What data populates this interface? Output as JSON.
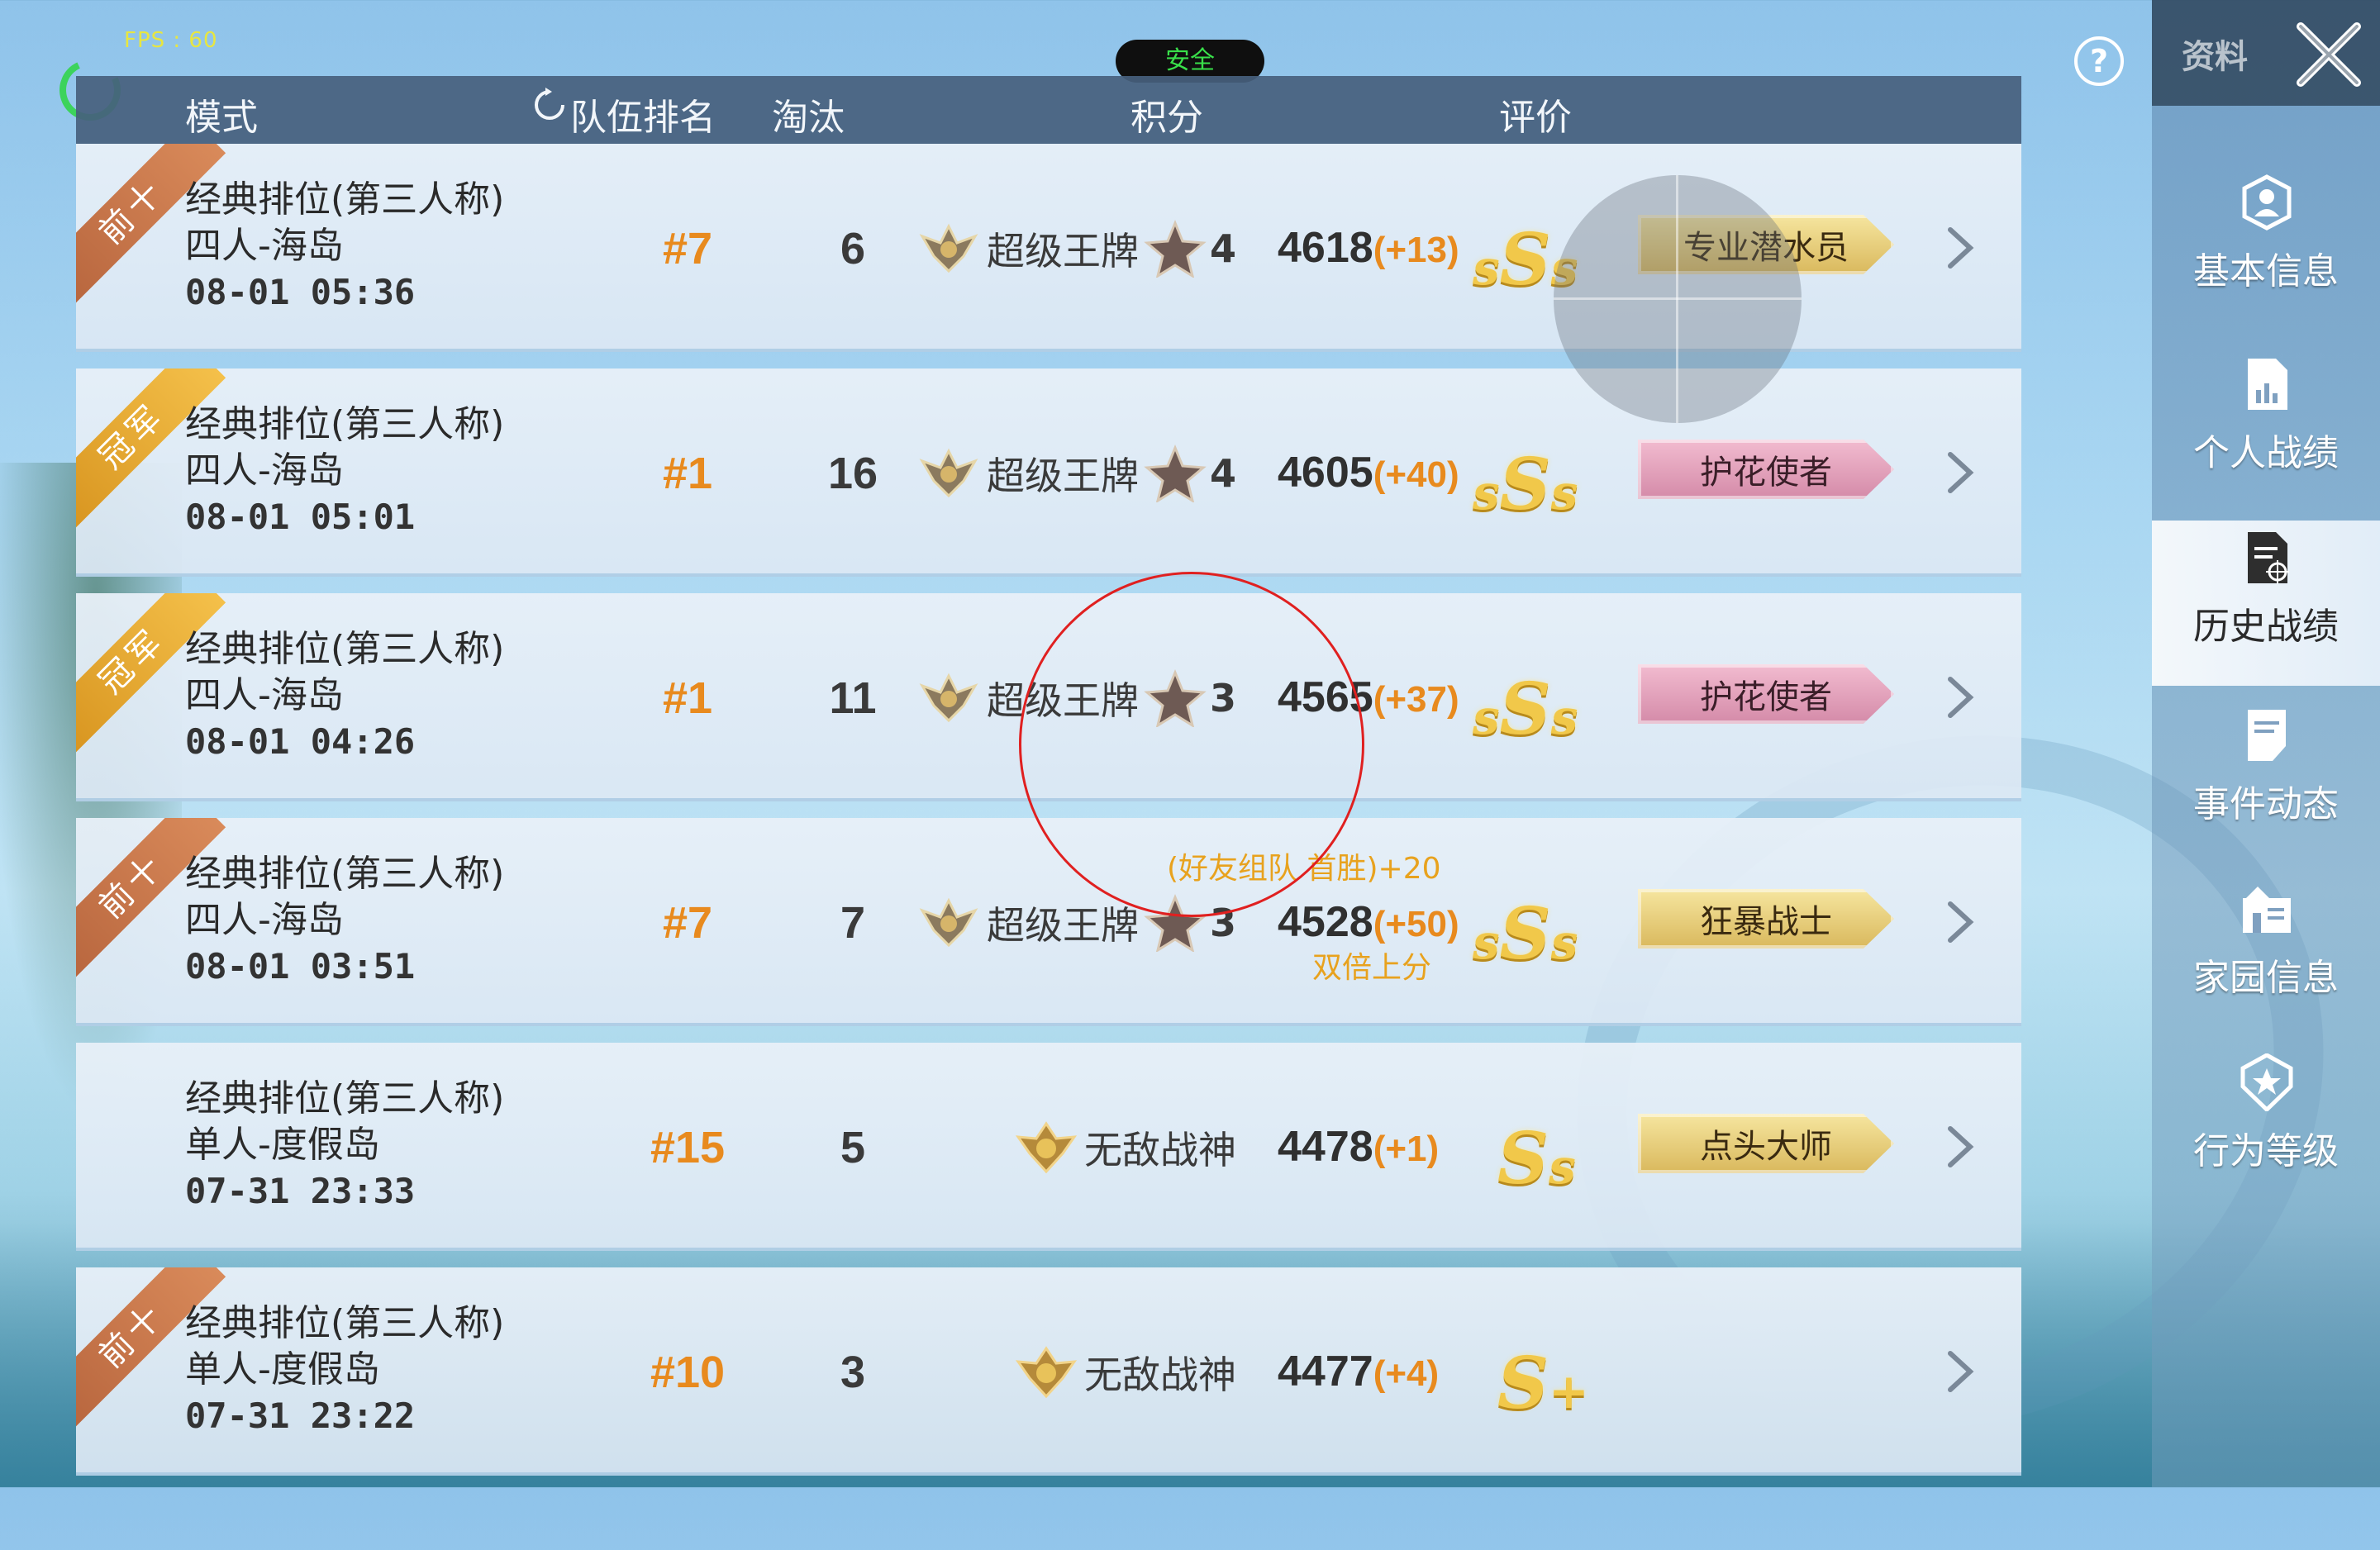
{
  "status": {
    "fps": "FPS : 60",
    "safe": "安全"
  },
  "header": {
    "mode": "模式",
    "team_rank": "队伍排名",
    "kills": "淘汰",
    "score": "积分",
    "rating": "评价"
  },
  "matches": [
    {
      "ribbon": "前十",
      "ribbon_type": "top10",
      "mode": "经典排位(第三人称)",
      "map": "四人-海岛",
      "time": "08-01 05:36",
      "rank": "#7",
      "kills": "6",
      "tier": "超级王牌",
      "stars": "4",
      "score": "4618",
      "delta": "(+13)",
      "rating_parts": [
        "s",
        "S",
        "s"
      ],
      "title": "专业潜水员",
      "title_style": "gold"
    },
    {
      "ribbon": "冠军",
      "ribbon_type": "champ",
      "mode": "经典排位(第三人称)",
      "map": "四人-海岛",
      "time": "08-01 05:01",
      "rank": "#1",
      "kills": "16",
      "tier": "超级王牌",
      "stars": "4",
      "score": "4605",
      "delta": "(+40)",
      "rating_parts": [
        "s",
        "S",
        "s"
      ],
      "title": "护花使者",
      "title_style": "pink"
    },
    {
      "ribbon": "冠军",
      "ribbon_type": "champ",
      "mode": "经典排位(第三人称)",
      "map": "四人-海岛",
      "time": "08-01 04:26",
      "rank": "#1",
      "kills": "11",
      "tier": "超级王牌",
      "stars": "3",
      "score": "4565",
      "delta": "(+37)",
      "rating_parts": [
        "s",
        "S",
        "s"
      ],
      "title": "护花使者",
      "title_style": "pink"
    },
    {
      "ribbon": "前十",
      "ribbon_type": "top10",
      "mode": "经典排位(第三人称)",
      "map": "四人-海岛",
      "time": "08-01 03:51",
      "rank": "#7",
      "kills": "7",
      "tier": "超级王牌",
      "stars": "3",
      "score": "4528",
      "delta": "(+50)",
      "bonus_top": "(好友组队 首胜)+20",
      "bonus_bottom": "双倍上分",
      "rating_parts": [
        "s",
        "S",
        "s"
      ],
      "title": "狂暴战士",
      "title_style": "gold"
    },
    {
      "ribbon": "",
      "ribbon_type": "none",
      "mode": "经典排位(第三人称)",
      "map": "单人-度假岛",
      "time": "07-31 23:33",
      "rank": "#15",
      "kills": "5",
      "tier": "无敌战神",
      "stars": "",
      "score": "4478",
      "delta": "(+1)",
      "rating_parts": [
        "S",
        "s"
      ],
      "title": "点头大师",
      "title_style": "gold"
    },
    {
      "ribbon": "前十",
      "ribbon_type": "top10",
      "mode": "经典排位(第三人称)",
      "map": "单人-度假岛",
      "time": "07-31 23:22",
      "rank": "#10",
      "kills": "3",
      "tier": "无敌战神",
      "stars": "",
      "score": "4477",
      "delta": "(+4)",
      "rating_parts": [
        "S",
        "+"
      ],
      "title": "",
      "title_style": "none"
    }
  ],
  "sidebar": {
    "title": "资料",
    "items": [
      {
        "label": "基本信息",
        "icon": "profile-icon"
      },
      {
        "label": "个人战绩",
        "icon": "chart-doc-icon"
      },
      {
        "label": "历史战绩",
        "icon": "history-doc-icon",
        "active": true
      },
      {
        "label": "事件动态",
        "icon": "event-doc-icon"
      },
      {
        "label": "家园信息",
        "icon": "home-icon"
      },
      {
        "label": "行为等级",
        "icon": "behavior-badge-icon"
      }
    ]
  },
  "colors": {
    "accent_orange": "#e88a1e",
    "header_bg": "#46607d",
    "gold": "#f1c84a"
  }
}
